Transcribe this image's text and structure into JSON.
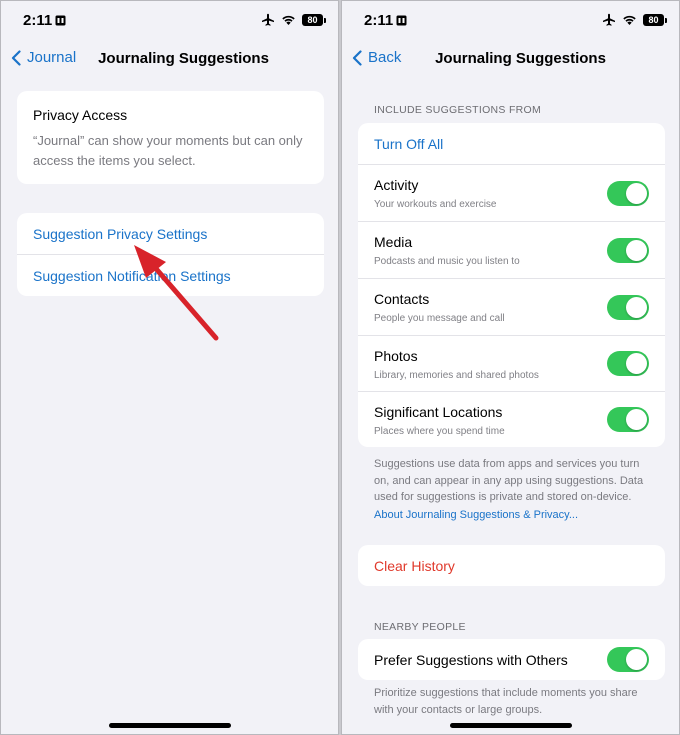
{
  "status": {
    "time": "2:11",
    "battery": "80"
  },
  "left": {
    "back_label": "Journal",
    "title": "Journaling Suggestions",
    "privacy": {
      "title": "Privacy Access",
      "body": "“Journal” can show your moments but can only access the items you select."
    },
    "links": [
      "Suggestion Privacy Settings",
      "Suggestion Notification Settings"
    ]
  },
  "right": {
    "back_label": "Back",
    "title": "Journaling Suggestions",
    "include_header": "INCLUDE SUGGESTIONS FROM",
    "turn_off_all": "Turn Off All",
    "sources": [
      {
        "title": "Activity",
        "subtitle": "Your workouts and exercise",
        "on": true
      },
      {
        "title": "Media",
        "subtitle": "Podcasts and music you listen to",
        "on": true
      },
      {
        "title": "Contacts",
        "subtitle": "People you message and call",
        "on": true
      },
      {
        "title": "Photos",
        "subtitle": "Library, memories and shared photos",
        "on": true
      },
      {
        "title": "Significant Locations",
        "subtitle": "Places where you spend time",
        "on": true
      }
    ],
    "footer_text": "Suggestions use data from apps and services you turn on, and can appear in any app using suggestions. Data used for suggestions is private and stored on-device.",
    "footer_link": "About Journaling Suggestions & Privacy...",
    "clear_history": "Clear History",
    "nearby_header": "NEARBY PEOPLE",
    "prefer_label": "Prefer Suggestions with Others",
    "prefer_on": true,
    "prefer_footer": "Prioritize suggestions that include moments you share with your contacts or large groups."
  },
  "colors": {
    "accent": "#1a73c9",
    "toggle_on": "#34c759",
    "destructive": "#e0392b",
    "annotation_arrow": "#d8232a"
  }
}
